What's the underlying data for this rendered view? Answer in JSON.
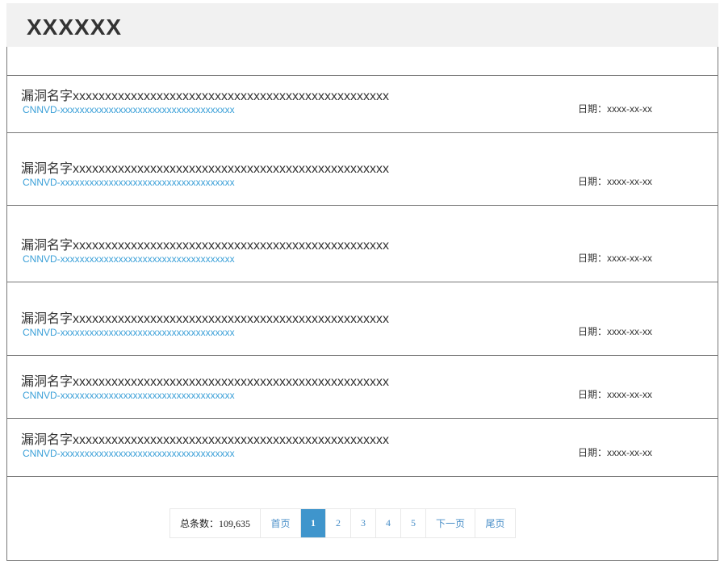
{
  "header": {
    "title": "XXXXXX"
  },
  "items": [
    {
      "title": "漏洞名字xxxxxxxxxxxxxxxxxxxxxxxxxxxxxxxxxxxxxxxxxxxxxxxxx",
      "id": "CNNVD-xxxxxxxxxxxxxxxxxxxxxxxxxxxxxxxxxxxx",
      "date": "日期：xxxx-xx-xx"
    },
    {
      "title": "漏洞名字xxxxxxxxxxxxxxxxxxxxxxxxxxxxxxxxxxxxxxxxxxxxxxxxx",
      "id": "CNNVD-xxxxxxxxxxxxxxxxxxxxxxxxxxxxxxxxxxxx",
      "date": "日期：xxxx-xx-xx"
    },
    {
      "title": "漏洞名字xxxxxxxxxxxxxxxxxxxxxxxxxxxxxxxxxxxxxxxxxxxxxxxxx",
      "id": "CNNVD-xxxxxxxxxxxxxxxxxxxxxxxxxxxxxxxxxxxx",
      "date": "日期：xxxx-xx-xx"
    },
    {
      "title": "漏洞名字xxxxxxxxxxxxxxxxxxxxxxxxxxxxxxxxxxxxxxxxxxxxxxxxx",
      "id": "CNNVD-xxxxxxxxxxxxxxxxxxxxxxxxxxxxxxxxxxxx",
      "date": "日期：xxxx-xx-xx"
    },
    {
      "title": "漏洞名字xxxxxxxxxxxxxxxxxxxxxxxxxxxxxxxxxxxxxxxxxxxxxxxxx",
      "id": "CNNVD-xxxxxxxxxxxxxxxxxxxxxxxxxxxxxxxxxxxx",
      "date": "日期：xxxx-xx-xx"
    },
    {
      "title": "漏洞名字xxxxxxxxxxxxxxxxxxxxxxxxxxxxxxxxxxxxxxxxxxxxxxxxx",
      "id": "CNNVD-xxxxxxxxxxxxxxxxxxxxxxxxxxxxxxxxxxxx",
      "date": "日期：xxxx-xx-xx"
    }
  ],
  "pagination": {
    "total": "总条数：109,635",
    "first": "首页",
    "pages": [
      "1",
      "2",
      "3",
      "4",
      "5"
    ],
    "current": "1",
    "next": "下一页",
    "last": "尾页"
  }
}
